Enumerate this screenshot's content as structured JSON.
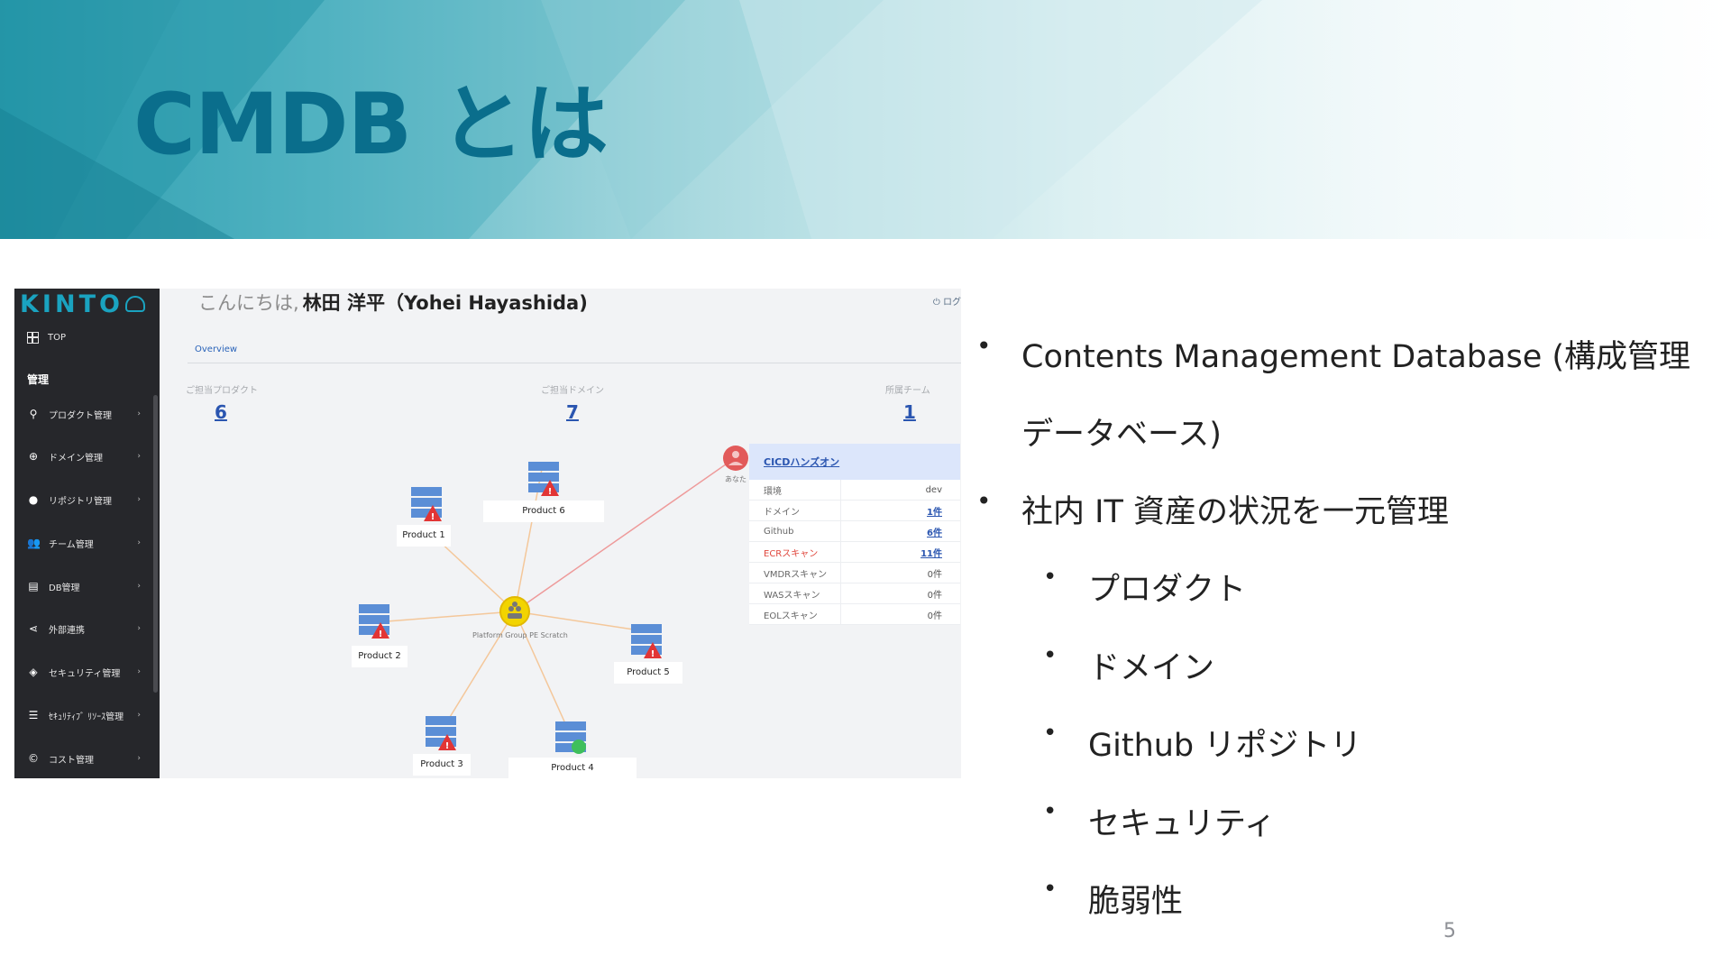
{
  "slide": {
    "title": "CMDB とは",
    "page_number": "5",
    "colors": {
      "title": "#0a6e8c",
      "banner_start": "#2a9cae",
      "banner_end": "#ffffff"
    }
  },
  "screenshot": {
    "logo": "KINTO",
    "nav_top": "TOP",
    "nav_section": "管理",
    "nav_items": [
      {
        "label": "プロダクト管理",
        "icon": "location-pin-icon"
      },
      {
        "label": "ドメイン管理",
        "icon": "globe-icon"
      },
      {
        "label": "リポジトリ管理",
        "icon": "github-icon"
      },
      {
        "label": "チーム管理",
        "icon": "people-icon"
      },
      {
        "label": "DB管理",
        "icon": "database-icon"
      },
      {
        "label": "外部連携",
        "icon": "share-icon"
      },
      {
        "label": "セキュリティ管理",
        "icon": "shield-icon"
      },
      {
        "label": "ｾｷｭﾘﾃｨﾌﾞ ﾘｿｰｽ管理",
        "icon": "server-list-icon"
      },
      {
        "label": "コスト管理",
        "icon": "copyright-icon"
      }
    ],
    "greeting_prefix": "こんにちは,",
    "greeting_name": "林田 洋平（Yohei Hayashida)",
    "logout": "⏻ ログ",
    "tab": "Overview",
    "stats": [
      {
        "label": "ご担当プロダクト",
        "value": "6"
      },
      {
        "label": "ご担当ドメイン",
        "value": "7"
      },
      {
        "label": "所属チーム",
        "value": "1"
      }
    ],
    "hub": "Platform Group PE Scratch",
    "you": "あなた",
    "products": [
      "Product 1",
      "Product 2",
      "Product 3",
      "Product 4",
      "Product 5",
      "Product 6"
    ],
    "info_panel": {
      "title": "CICDハンズオン",
      "rows": [
        {
          "key": "環境",
          "value": "dev"
        },
        {
          "key": "ドメイン",
          "value": "1件"
        },
        {
          "key": "Github",
          "value": "6件"
        },
        {
          "key": "ECRスキャン",
          "value": "11件"
        },
        {
          "key": "VMDRスキャン",
          "value": "0件"
        },
        {
          "key": "WASスキャン",
          "value": "0件"
        },
        {
          "key": "EOLスキャン",
          "value": "0件"
        }
      ]
    }
  },
  "bullets": {
    "item1_line1": "Contents Management Database (構成管理",
    "item1_line2": "データベース)",
    "item2": "社内 IT 資産の状況を一元管理",
    "sub": [
      "プロダクト",
      "ドメイン",
      "Github リポジトリ",
      "セキュリティ",
      "脆弱性"
    ]
  }
}
